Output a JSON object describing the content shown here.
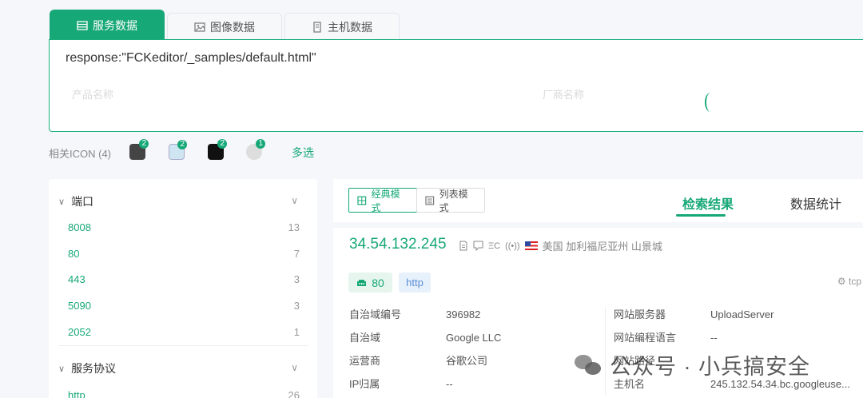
{
  "tabs": [
    {
      "label": "服务数据",
      "icon": "table-icon",
      "active": true
    },
    {
      "label": "图像数据",
      "icon": "image-icon",
      "active": false
    },
    {
      "label": "主机数据",
      "icon": "server-icon",
      "active": false
    }
  ],
  "query": {
    "text": "response:\"FCKeditor/_samples/default.html\"",
    "placeholder_product": "产品名称",
    "placeholder_vendor": "厂商名称"
  },
  "icon_row": {
    "label": "相关ICON (4)",
    "icons": [
      {
        "name": "related-icon-1",
        "badge": "2"
      },
      {
        "name": "related-icon-2",
        "badge": "2"
      },
      {
        "name": "related-icon-3",
        "badge": "2"
      },
      {
        "name": "related-icon-4",
        "badge": "1"
      }
    ],
    "multi_select": "多选"
  },
  "sidebar": {
    "port_section": {
      "title": "端口",
      "items": [
        {
          "label": "8008",
          "count": "13"
        },
        {
          "label": "80",
          "count": "7"
        },
        {
          "label": "443",
          "count": "3"
        },
        {
          "label": "5090",
          "count": "3"
        },
        {
          "label": "2052",
          "count": "1"
        }
      ]
    },
    "protocol_section": {
      "title": "服务协议",
      "items": [
        {
          "label": "http",
          "count": "26"
        }
      ]
    }
  },
  "modes": {
    "classic": "经典模式",
    "list": "列表模式"
  },
  "result_tabs": {
    "search_results": "检索结果",
    "statistics": "数据统计"
  },
  "result": {
    "ip": "34.54.132.245",
    "location": "美国 加利福尼亚州 山景城",
    "meta_icon_3": "ΞC",
    "port": "80",
    "protocol": "http",
    "transport": "tcp",
    "left_fields": [
      {
        "key": "自治域编号",
        "value": "396982"
      },
      {
        "key": "自治域",
        "value": "Google LLC"
      },
      {
        "key": "运营商",
        "value": "谷歌公司"
      },
      {
        "key": "IP归属",
        "value": "--"
      }
    ],
    "right_fields": [
      {
        "key": "网站服务器",
        "value": "UploadServer"
      },
      {
        "key": "网站编程语言",
        "value": "--"
      },
      {
        "key": "网站路径",
        "value": ""
      },
      {
        "key": "主机名",
        "value": "245.132.54.34.bc.googleuse..."
      }
    ]
  },
  "watermark": "公众号 · 小兵搞安全",
  "colors": {
    "accent": "#17a877",
    "protocol": "#5b8ed6"
  }
}
